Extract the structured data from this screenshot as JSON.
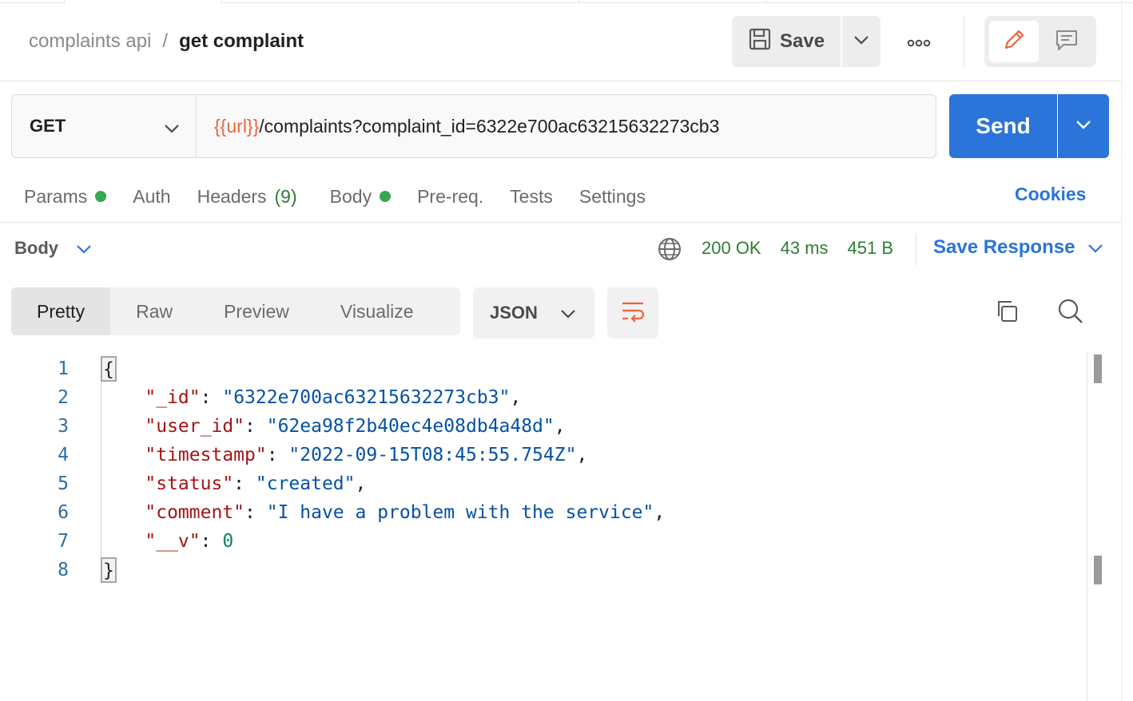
{
  "breadcrumb": {
    "parent": "complaints api",
    "separator": "/",
    "current": "get complaint"
  },
  "toolbar": {
    "save_label": "Save",
    "more_label": "ooo"
  },
  "request": {
    "method": "GET",
    "url_variable": "{{url}}",
    "url_path": "/complaints?complaint_id=6322e700ac63215632273cb3",
    "send_label": "Send"
  },
  "request_tabs": {
    "params": "Params",
    "auth": "Auth",
    "headers": "Headers",
    "headers_count": "(9)",
    "body": "Body",
    "prereq": "Pre-req.",
    "tests": "Tests",
    "settings": "Settings",
    "cookies": "Cookies"
  },
  "response": {
    "body_label": "Body",
    "status": "200 OK",
    "time": "43 ms",
    "size": "451 B",
    "save_response": "Save Response"
  },
  "view_tabs": {
    "pretty": "Pretty",
    "raw": "Raw",
    "preview": "Preview",
    "visualize": "Visualize"
  },
  "format": "JSON",
  "code": {
    "lines": [
      "1",
      "2",
      "3",
      "4",
      "5",
      "6",
      "7",
      "8"
    ],
    "open_brace": "{",
    "close_brace": "}",
    "fields": [
      {
        "key": "\"_id\"",
        "value": "\"6322e700ac63215632273cb3\"",
        "trail": ","
      },
      {
        "key": "\"user_id\"",
        "value": "\"62ea98f2b40ec4e08db4a48d\"",
        "trail": ","
      },
      {
        "key": "\"timestamp\"",
        "value": "\"2022-09-15T08:45:55.754Z\"",
        "trail": ","
      },
      {
        "key": "\"status\"",
        "value": "\"created\"",
        "trail": ","
      },
      {
        "key": "\"comment\"",
        "value": "\"I have a problem with the service\"",
        "trail": ","
      },
      {
        "key": "\"__v\"",
        "value": "0",
        "trail": ""
      }
    ]
  },
  "colors": {
    "accent": "#2b74d9",
    "success": "#2e7d32",
    "variable": "#e9643a",
    "json_key": "#a31515",
    "json_string": "#0451a5",
    "json_number": "#098658"
  }
}
